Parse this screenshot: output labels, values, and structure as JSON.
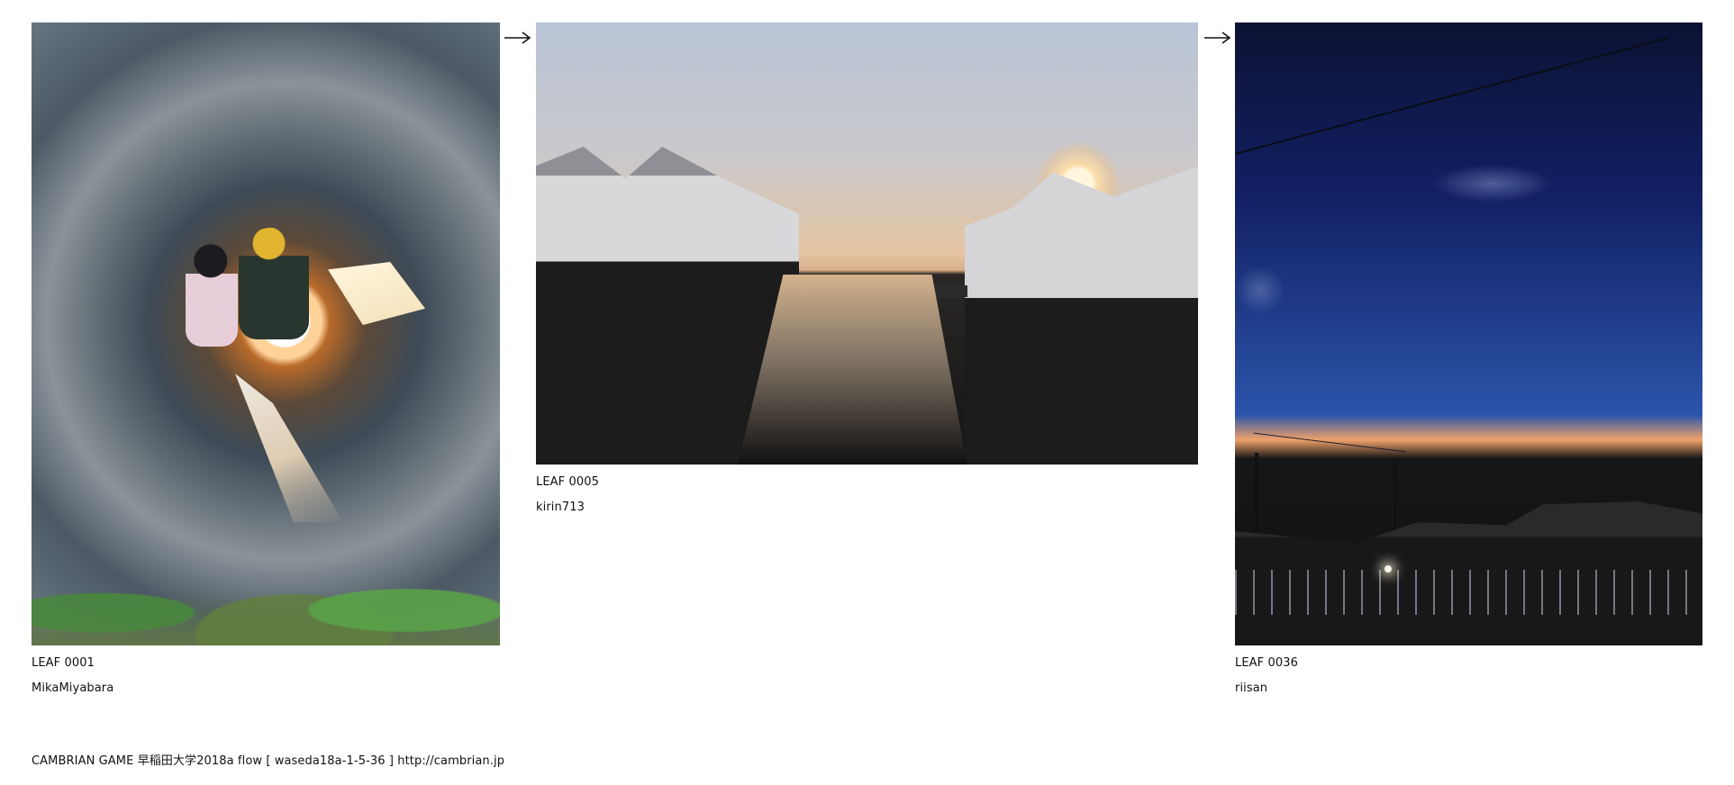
{
  "leaves": [
    {
      "id_label": "LEAF 0001",
      "user": "MikaMiyabara",
      "photo_icon": "tunnel-children-photo-icon"
    },
    {
      "id_label": "LEAF 0005",
      "user": "kirin713",
      "photo_icon": "canal-sunset-photo-icon"
    },
    {
      "id_label": "LEAF 0036",
      "user": "riisan",
      "photo_icon": "night-sky-town-photo-icon"
    }
  ],
  "connectors": [
    {
      "icon": "arrow-right-icon"
    },
    {
      "icon": "arrow-right-icon"
    }
  ],
  "footer": {
    "text": "CAMBRIAN GAME  早稲田大学2018a  flow [ waseda18a-1-5-36 ]    http://cambrian.jp"
  }
}
